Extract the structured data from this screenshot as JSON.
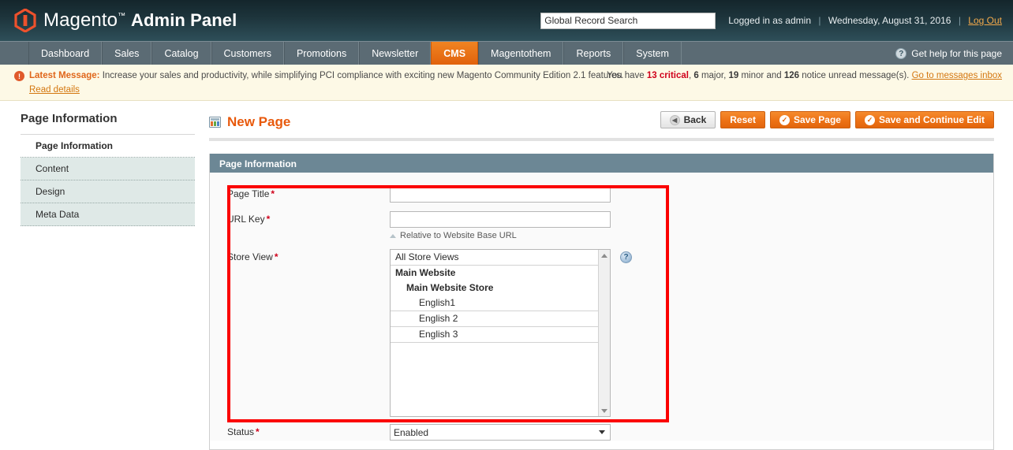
{
  "header": {
    "logo_text_light": "Magento",
    "logo_tm": "™",
    "logo_text_bold": "Admin Panel",
    "search_value": "Global Record Search",
    "search_placeholder": "Global Record Search",
    "logged_in": "Logged in as admin",
    "date": "Wednesday, August 31, 2016",
    "logout": "Log Out",
    "separator": "|"
  },
  "nav": {
    "items": [
      {
        "label": "Dashboard",
        "active": false
      },
      {
        "label": "Sales",
        "active": false
      },
      {
        "label": "Catalog",
        "active": false
      },
      {
        "label": "Customers",
        "active": false
      },
      {
        "label": "Promotions",
        "active": false
      },
      {
        "label": "Newsletter",
        "active": false
      },
      {
        "label": "CMS",
        "active": true
      },
      {
        "label": "Magentothem",
        "active": false
      },
      {
        "label": "Reports",
        "active": false
      },
      {
        "label": "System",
        "active": false
      }
    ],
    "help_label": "Get help for this page",
    "help_icon_glyph": "?"
  },
  "message_bar": {
    "icon_glyph": "!",
    "latest_label": "Latest Message:",
    "text": "Increase your sales and productivity, while simplifying PCI compliance with exciting new Magento Community Edition 2.1 features.",
    "read_details": "Read details",
    "counts_prefix": "You have",
    "critical_count": "13",
    "critical_label": "critical",
    "major_count": "6",
    "major_label": "major",
    "minor_count": "19",
    "minor_label": "minor",
    "notice_count": "126",
    "notice_label": "notice unread message(s).",
    "and_word": "and",
    "inbox_link": "Go to messages inbox"
  },
  "sidebar": {
    "title": "Page Information",
    "tabs": [
      {
        "label": "Page Information",
        "active": true
      },
      {
        "label": "Content",
        "active": false
      },
      {
        "label": "Design",
        "active": false
      },
      {
        "label": "Meta Data",
        "active": false
      }
    ]
  },
  "main": {
    "page_title": "New Page",
    "buttons": [
      {
        "label": "Back",
        "style": "gray",
        "icon": "back-arrow-icon"
      },
      {
        "label": "Reset",
        "style": "orange",
        "icon": ""
      },
      {
        "label": "Save Page",
        "style": "orange",
        "icon": "check-icon"
      },
      {
        "label": "Save and Continue Edit",
        "style": "orange",
        "icon": "check-icon"
      }
    ],
    "panel_title": "Page Information",
    "fields": {
      "page_title": {
        "label": "Page Title",
        "required": "*",
        "value": ""
      },
      "url_key": {
        "label": "URL Key",
        "required": "*",
        "value": "",
        "hint": "Relative to Website Base URL"
      },
      "store_view": {
        "label": "Store View",
        "required": "*",
        "tip_glyph": "?",
        "options": [
          {
            "label": "All Store Views",
            "level": "all"
          },
          {
            "label": "Main Website",
            "level": "website"
          },
          {
            "label": "Main Website Store",
            "level": "store"
          },
          {
            "label": "English1",
            "level": "view"
          },
          {
            "label": "English 2",
            "level": "view"
          },
          {
            "label": "English 3",
            "level": "view"
          }
        ]
      },
      "status": {
        "label": "Status",
        "required": "*",
        "value": "Enabled",
        "caret_glyph": "▼"
      }
    }
  },
  "colors": {
    "accent_orange": "#e8590c",
    "nav_active": "#ed7216",
    "panel_header": "#6c8795",
    "annotation_red": "#fb0000",
    "critical_red": "#d0021b",
    "header_dark": "#1d343b"
  }
}
